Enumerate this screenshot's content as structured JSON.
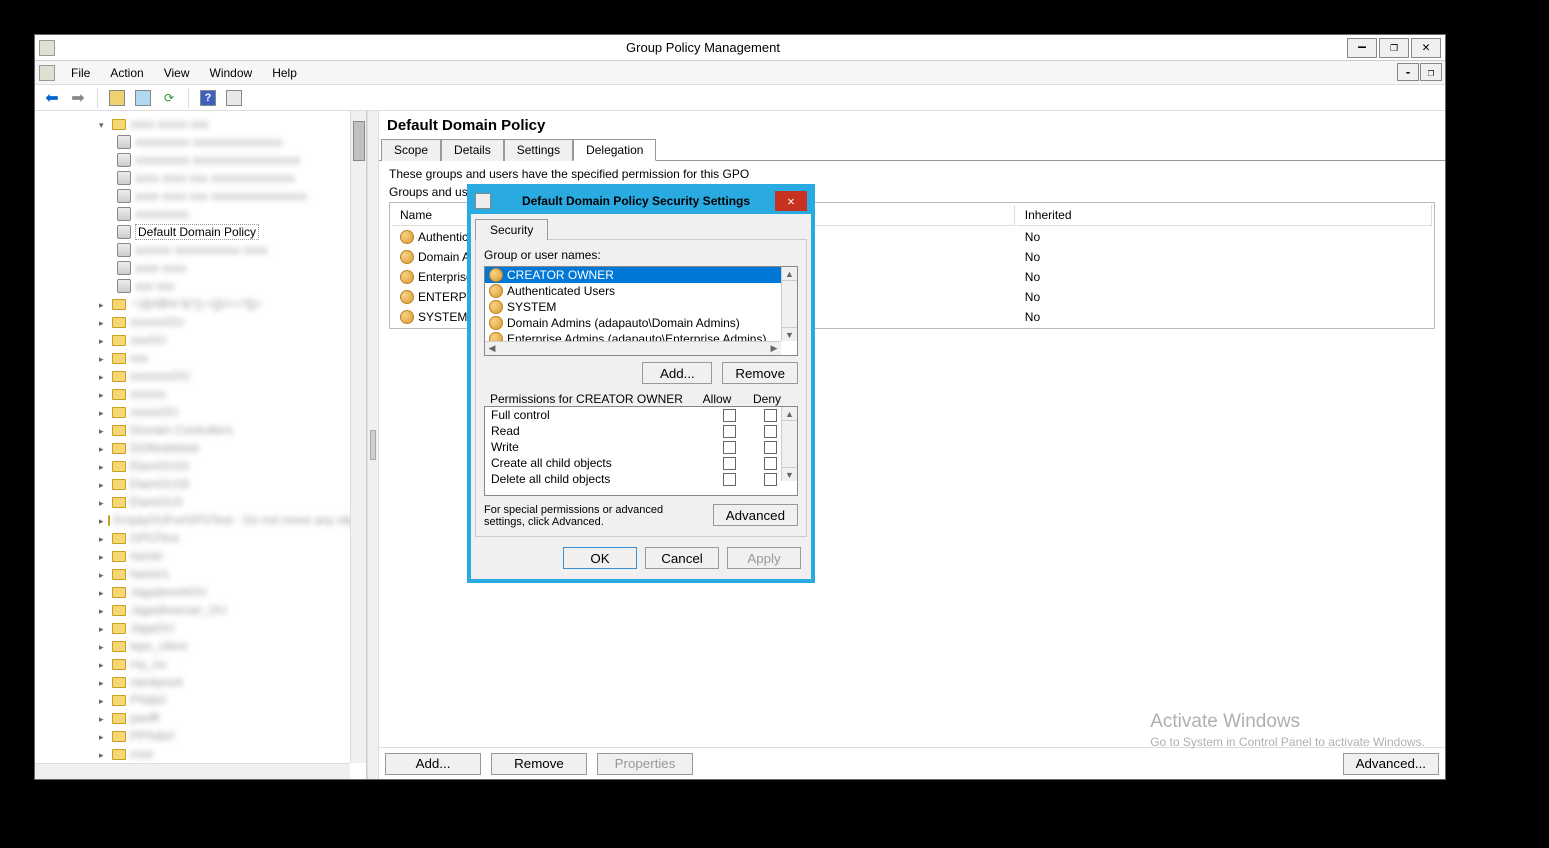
{
  "window": {
    "title": "Group Policy Management"
  },
  "menubar": {
    "file": "File",
    "action": "Action",
    "view": "View",
    "window": "Window",
    "help": "Help"
  },
  "tree": {
    "selected": "Default Domain Policy"
  },
  "main": {
    "title": "Default Domain Policy",
    "tabs": {
      "scope": "Scope",
      "details": "Details",
      "settings": "Settings",
      "delegation": "Delegation"
    },
    "deleg_desc": "These groups and users have the specified permission for this GPO",
    "deleg_label": "Groups and users:",
    "cols": {
      "name": "Name",
      "inherited": "Inherited"
    },
    "rows": [
      {
        "name": "Authenticated",
        "inherited": "No"
      },
      {
        "name": "Domain Admin",
        "inherited": "No"
      },
      {
        "name": "Enterprise Adm",
        "inherited": "No"
      },
      {
        "name": "ENTERPRISE",
        "inherited": "No"
      },
      {
        "name": "SYSTEM",
        "inherited": "No"
      }
    ],
    "btn_add": "Add...",
    "btn_remove": "Remove",
    "btn_props": "Properties",
    "btn_adv": "Advanced..."
  },
  "dialog": {
    "title": "Default Domain Policy Security Settings",
    "tab": "Security",
    "grp_label": "Group or user names:",
    "groups": [
      "CREATOR OWNER",
      "Authenticated Users",
      "SYSTEM",
      "Domain Admins (adapauto\\Domain Admins)",
      "Enterprise Admins (adapauto\\Enterprise Admins)"
    ],
    "btn_add": "Add...",
    "btn_remove": "Remove",
    "perm_label": "Permissions for CREATOR OWNER",
    "col_allow": "Allow",
    "col_deny": "Deny",
    "perms": [
      "Full control",
      "Read",
      "Write",
      "Create all child objects",
      "Delete all child objects"
    ],
    "spec_text": "For special permissions or advanced settings, click Advanced.",
    "btn_adv": "Advanced",
    "btn_ok": "OK",
    "btn_cancel": "Cancel",
    "btn_apply": "Apply"
  },
  "watermark": {
    "title": "Activate Windows",
    "sub": "Go to System in Control Panel to activate Windows."
  }
}
